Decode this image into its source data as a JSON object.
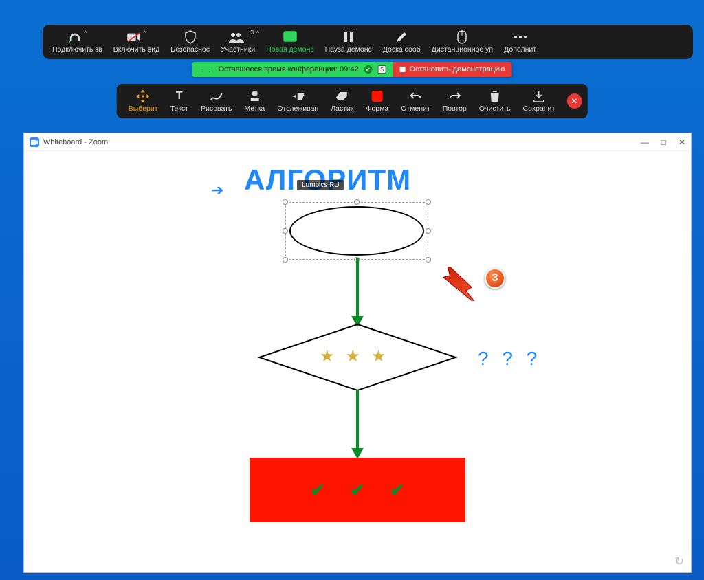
{
  "toolbar": {
    "audio": {
      "label": "Подключить зв",
      "has_chevron": true
    },
    "video": {
      "label": "Включить вид",
      "has_chevron": true
    },
    "security": {
      "label": "Безопаснос"
    },
    "participants": {
      "label": "Участники",
      "count": "3",
      "has_chevron": true
    },
    "share": {
      "label": "Новая демонс"
    },
    "pause": {
      "label": "Пауза демонс"
    },
    "whiteboard": {
      "label": "Доска сооб"
    },
    "remote": {
      "label": "Дистанционное уп"
    },
    "more": {
      "label": "Дополнит"
    }
  },
  "status": {
    "time_text": "Оставшееся время конференции: 09:42",
    "stop_text": "Остановить демонстрацию"
  },
  "annotation": {
    "select": "Выберит",
    "text": "Текст",
    "draw": "Рисовать",
    "mark": "Метка",
    "spotlight": "Отслеживан",
    "eraser": "Ластик",
    "shape": "Форма",
    "undo": "Отменит",
    "redo": "Повтор",
    "clear": "Очистить",
    "save": "Сохранит"
  },
  "window": {
    "title": "Whiteboard - Zoom"
  },
  "canvas": {
    "title": "АЛГОРИТМ",
    "watermark": "Lumpics RU",
    "question_marks": "? ? ?",
    "step_number": "3"
  }
}
